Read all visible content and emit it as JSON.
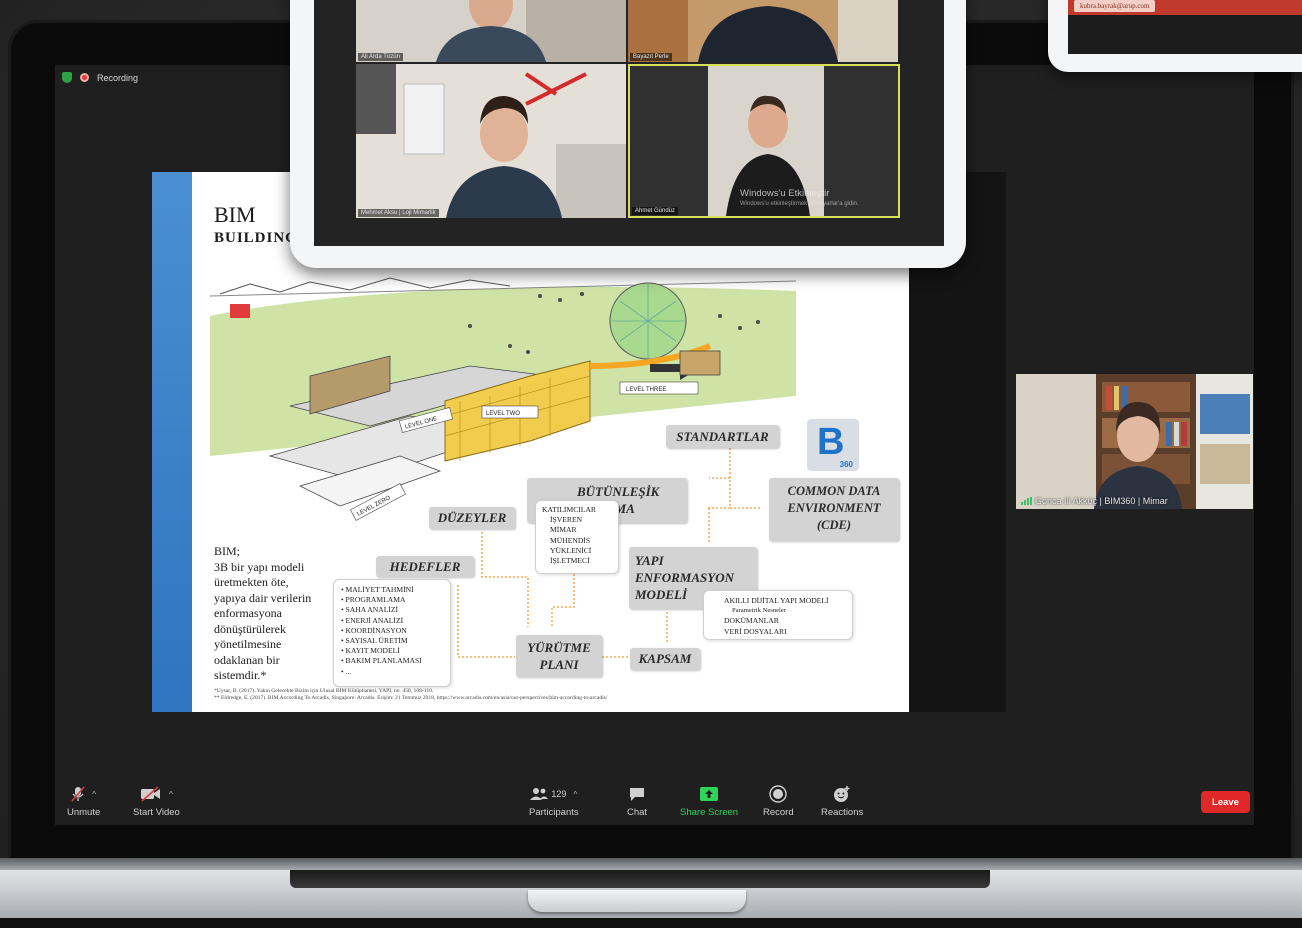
{
  "meeting": {
    "recording_label": "Recording",
    "self_view_name": "Gonca Ili Akküç | BIM360 | Mimar"
  },
  "slide": {
    "title": "BIM",
    "subtitle": "BUILDING",
    "description_lines": [
      "BIM;",
      "3B bir yapı modeli",
      "üretmekten öte,",
      "yapıya dair verilerin",
      "enformasyona",
      "dönüştürülerek",
      "yönetilmesine",
      "odaklanan bir",
      "sistemdir.*"
    ],
    "level_labels": {
      "one": "LEVEL ONE",
      "two": "LEVEL TWO",
      "three": "LEVEL THREE",
      "zero": "LEVEL ZERO"
    },
    "boxes": {
      "standartlar": "STANDARTLAR",
      "butunlesik": [
        "BÜTÜNLEŞİK",
        "ÇALIŞMA"
      ],
      "cde": [
        "COMMON DATA",
        "ENVIRONMENT",
        "(CDE)"
      ],
      "duzeyler": "DÜZEYLER",
      "yapi": [
        "YAPI",
        "ENFORMASYON",
        "MODELİ"
      ],
      "hedefler": "HEDEFLER",
      "yurutme": [
        "YÜRÜTME",
        "PLANI"
      ],
      "kapsam": "KAPSAM"
    },
    "katilimcilar": [
      "KATILIMCILAR",
      "İŞVEREN",
      "MİMAR",
      "MÜHENDİS",
      "YÜKLENİCİ",
      "İŞLETMECİ"
    ],
    "hedefler_list": [
      "• MALİYET TAHMİNİ",
      "• PROGRAMLAMA",
      "• SAHA ANALİZİ",
      "• ENERJİ ANALİZİ",
      "• KOORDİNASYON",
      "• SAYISAL ÜRETİM",
      "• KAYIT MODELİ",
      "• BAKIM PLANLAMASI",
      "• ..."
    ],
    "yapi_list": [
      "AKILLI DİJİTAL YAPI MODELİ",
      "Parametrik Nesneler",
      "DOKÜMANLAR",
      "VERİ DOSYALARI"
    ],
    "logo_b": "B",
    "logo_360": "360",
    "footnotes": [
      "*Uysar, B. (2017). Yakın Gelecekte Bizim için Ulusal BIM Kütüphanesi, YAPI, no. 450, 108-110.",
      "** Eldredge, E. (2017). BIM According To Arcadis, Singapore: Arcadis. Erişim: 21 Temmuz 2018, https://www.arcadis.com/en/asia/our-perspectives/bim-according-to-arcadis/"
    ]
  },
  "toolbar": {
    "unmute": "Unmute",
    "start_video": "Start Video",
    "participants_count": "129",
    "participants": "Participants",
    "chat": "Chat",
    "share_screen": "Share Screen",
    "record": "Record",
    "reactions": "Reactions",
    "leave": "Leave"
  },
  "tablet": {
    "tiles": [
      {
        "name": "Ali Arda Tüzün"
      },
      {
        "name": "Bayazıt Perle"
      },
      {
        "name": "Mehmet Aksu | Lojl Mimarlik"
      },
      {
        "name": "Ahmet Gündüz"
      }
    ],
    "watermark_title": "Windows'u Etkinleştir",
    "watermark_sub": "Windows'u etkinleştirmek için Ayarlar'a gidin."
  },
  "tablet2": {
    "email": "kubra.bayrak@arup.com"
  },
  "colors": {
    "accent_green": "#2fd45a",
    "leave_red": "#e02828",
    "slide_blue": "#2f75bf"
  }
}
